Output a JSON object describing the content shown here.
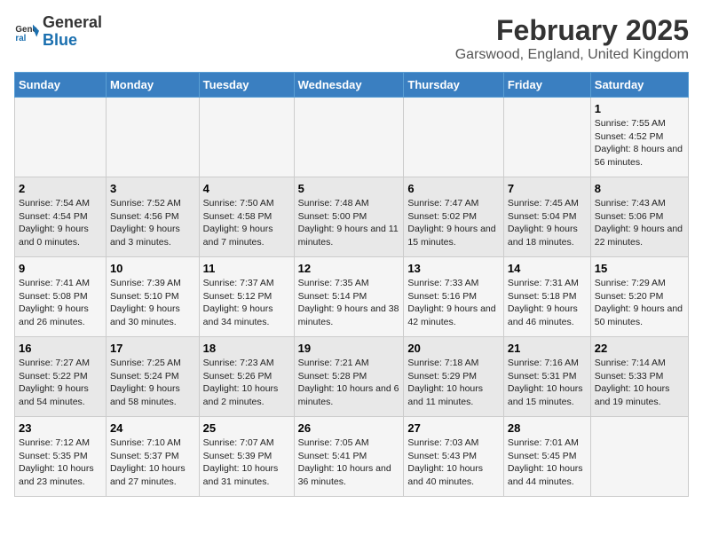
{
  "logo": {
    "line1": "General",
    "line2": "Blue"
  },
  "title": "February 2025",
  "subtitle": "Garswood, England, United Kingdom",
  "days_of_week": [
    "Sunday",
    "Monday",
    "Tuesday",
    "Wednesday",
    "Thursday",
    "Friday",
    "Saturday"
  ],
  "weeks": [
    [
      {
        "num": "",
        "info": ""
      },
      {
        "num": "",
        "info": ""
      },
      {
        "num": "",
        "info": ""
      },
      {
        "num": "",
        "info": ""
      },
      {
        "num": "",
        "info": ""
      },
      {
        "num": "",
        "info": ""
      },
      {
        "num": "1",
        "info": "Sunrise: 7:55 AM\nSunset: 4:52 PM\nDaylight: 8 hours and 56 minutes."
      }
    ],
    [
      {
        "num": "2",
        "info": "Sunrise: 7:54 AM\nSunset: 4:54 PM\nDaylight: 9 hours and 0 minutes."
      },
      {
        "num": "3",
        "info": "Sunrise: 7:52 AM\nSunset: 4:56 PM\nDaylight: 9 hours and 3 minutes."
      },
      {
        "num": "4",
        "info": "Sunrise: 7:50 AM\nSunset: 4:58 PM\nDaylight: 9 hours and 7 minutes."
      },
      {
        "num": "5",
        "info": "Sunrise: 7:48 AM\nSunset: 5:00 PM\nDaylight: 9 hours and 11 minutes."
      },
      {
        "num": "6",
        "info": "Sunrise: 7:47 AM\nSunset: 5:02 PM\nDaylight: 9 hours and 15 minutes."
      },
      {
        "num": "7",
        "info": "Sunrise: 7:45 AM\nSunset: 5:04 PM\nDaylight: 9 hours and 18 minutes."
      },
      {
        "num": "8",
        "info": "Sunrise: 7:43 AM\nSunset: 5:06 PM\nDaylight: 9 hours and 22 minutes."
      }
    ],
    [
      {
        "num": "9",
        "info": "Sunrise: 7:41 AM\nSunset: 5:08 PM\nDaylight: 9 hours and 26 minutes."
      },
      {
        "num": "10",
        "info": "Sunrise: 7:39 AM\nSunset: 5:10 PM\nDaylight: 9 hours and 30 minutes."
      },
      {
        "num": "11",
        "info": "Sunrise: 7:37 AM\nSunset: 5:12 PM\nDaylight: 9 hours and 34 minutes."
      },
      {
        "num": "12",
        "info": "Sunrise: 7:35 AM\nSunset: 5:14 PM\nDaylight: 9 hours and 38 minutes."
      },
      {
        "num": "13",
        "info": "Sunrise: 7:33 AM\nSunset: 5:16 PM\nDaylight: 9 hours and 42 minutes."
      },
      {
        "num": "14",
        "info": "Sunrise: 7:31 AM\nSunset: 5:18 PM\nDaylight: 9 hours and 46 minutes."
      },
      {
        "num": "15",
        "info": "Sunrise: 7:29 AM\nSunset: 5:20 PM\nDaylight: 9 hours and 50 minutes."
      }
    ],
    [
      {
        "num": "16",
        "info": "Sunrise: 7:27 AM\nSunset: 5:22 PM\nDaylight: 9 hours and 54 minutes."
      },
      {
        "num": "17",
        "info": "Sunrise: 7:25 AM\nSunset: 5:24 PM\nDaylight: 9 hours and 58 minutes."
      },
      {
        "num": "18",
        "info": "Sunrise: 7:23 AM\nSunset: 5:26 PM\nDaylight: 10 hours and 2 minutes."
      },
      {
        "num": "19",
        "info": "Sunrise: 7:21 AM\nSunset: 5:28 PM\nDaylight: 10 hours and 6 minutes."
      },
      {
        "num": "20",
        "info": "Sunrise: 7:18 AM\nSunset: 5:29 PM\nDaylight: 10 hours and 11 minutes."
      },
      {
        "num": "21",
        "info": "Sunrise: 7:16 AM\nSunset: 5:31 PM\nDaylight: 10 hours and 15 minutes."
      },
      {
        "num": "22",
        "info": "Sunrise: 7:14 AM\nSunset: 5:33 PM\nDaylight: 10 hours and 19 minutes."
      }
    ],
    [
      {
        "num": "23",
        "info": "Sunrise: 7:12 AM\nSunset: 5:35 PM\nDaylight: 10 hours and 23 minutes."
      },
      {
        "num": "24",
        "info": "Sunrise: 7:10 AM\nSunset: 5:37 PM\nDaylight: 10 hours and 27 minutes."
      },
      {
        "num": "25",
        "info": "Sunrise: 7:07 AM\nSunset: 5:39 PM\nDaylight: 10 hours and 31 minutes."
      },
      {
        "num": "26",
        "info": "Sunrise: 7:05 AM\nSunset: 5:41 PM\nDaylight: 10 hours and 36 minutes."
      },
      {
        "num": "27",
        "info": "Sunrise: 7:03 AM\nSunset: 5:43 PM\nDaylight: 10 hours and 40 minutes."
      },
      {
        "num": "28",
        "info": "Sunrise: 7:01 AM\nSunset: 5:45 PM\nDaylight: 10 hours and 44 minutes."
      },
      {
        "num": "",
        "info": ""
      }
    ]
  ]
}
